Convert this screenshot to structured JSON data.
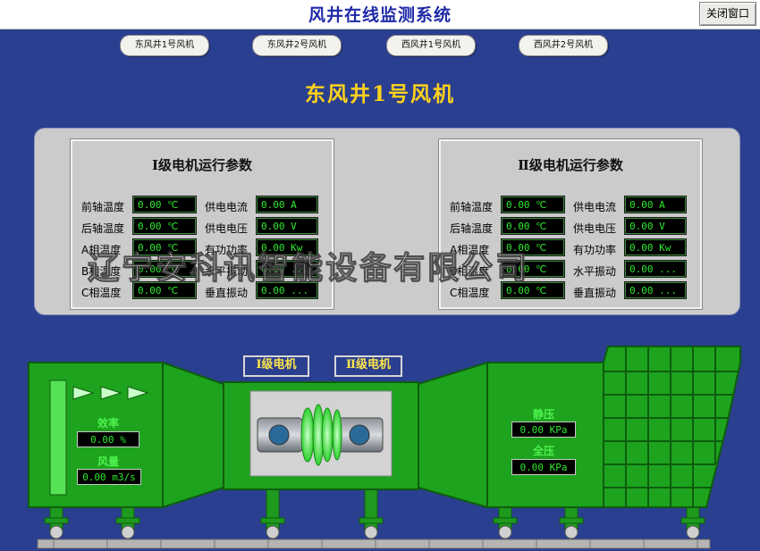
{
  "window": {
    "title": "风井在线监测系统",
    "close_label": "关闭窗口"
  },
  "fan_tabs": [
    "东风井1号风机",
    "东风井2号风机",
    "西风井1号风机",
    "西风井2号风机"
  ],
  "fan_title": "东风井1号风机",
  "motor1": {
    "title": "Ⅰ级电机运行参数",
    "rows": [
      {
        "l1": "前轴温度",
        "v1": "0.00 ℃",
        "l2": "供电电流",
        "v2": "0.00 A"
      },
      {
        "l1": "后轴温度",
        "v1": "0.00 ℃",
        "l2": "供电电压",
        "v2": "0.00 V"
      },
      {
        "l1": "A相温度",
        "v1": "0.00 ℃",
        "l2": "有功功率",
        "v2": "0.00 Kw"
      },
      {
        "l1": "B相温度",
        "v1": "0.00 ℃",
        "l2": "水平振动",
        "v2": "0.00 ..."
      },
      {
        "l1": "C相温度",
        "v1": "0.00 ℃",
        "l2": "垂直振动",
        "v2": "0.00 ..."
      }
    ]
  },
  "motor2": {
    "title": "Ⅱ级电机运行参数",
    "rows": [
      {
        "l1": "前轴温度",
        "v1": "0.00 ℃",
        "l2": "供电电流",
        "v2": "0.00 A"
      },
      {
        "l1": "后轴温度",
        "v1": "0.00 ℃",
        "l2": "供电电压",
        "v2": "0.00 V"
      },
      {
        "l1": "A相温度",
        "v1": "0.00 ℃",
        "l2": "有功功率",
        "v2": "0.00 Kw"
      },
      {
        "l1": "B相温度",
        "v1": "0.00 ℃",
        "l2": "水平振动",
        "v2": "0.00 ..."
      },
      {
        "l1": "C相温度",
        "v1": "0.00 ℃",
        "l2": "垂直振动",
        "v2": "0.00 ..."
      }
    ]
  },
  "watermark": "辽宁安科讯智能设备有限公司",
  "diagram": {
    "motor1_label": "Ⅰ级电机",
    "motor2_label": "Ⅱ级电机",
    "efficiency_label": "效率",
    "efficiency_value": "0.00 %",
    "airflow_label": "风量",
    "airflow_value": "0.00 m3/s",
    "static_label": "静压",
    "static_value": "0.00 KPa",
    "total_label": "全压",
    "total_value": "0.00 KPa"
  },
  "colors": {
    "background": "#2a3f8f",
    "machine_green": "#1ea31e",
    "readout_green": "#2ee82e",
    "fan_title": "#ffd21c"
  }
}
